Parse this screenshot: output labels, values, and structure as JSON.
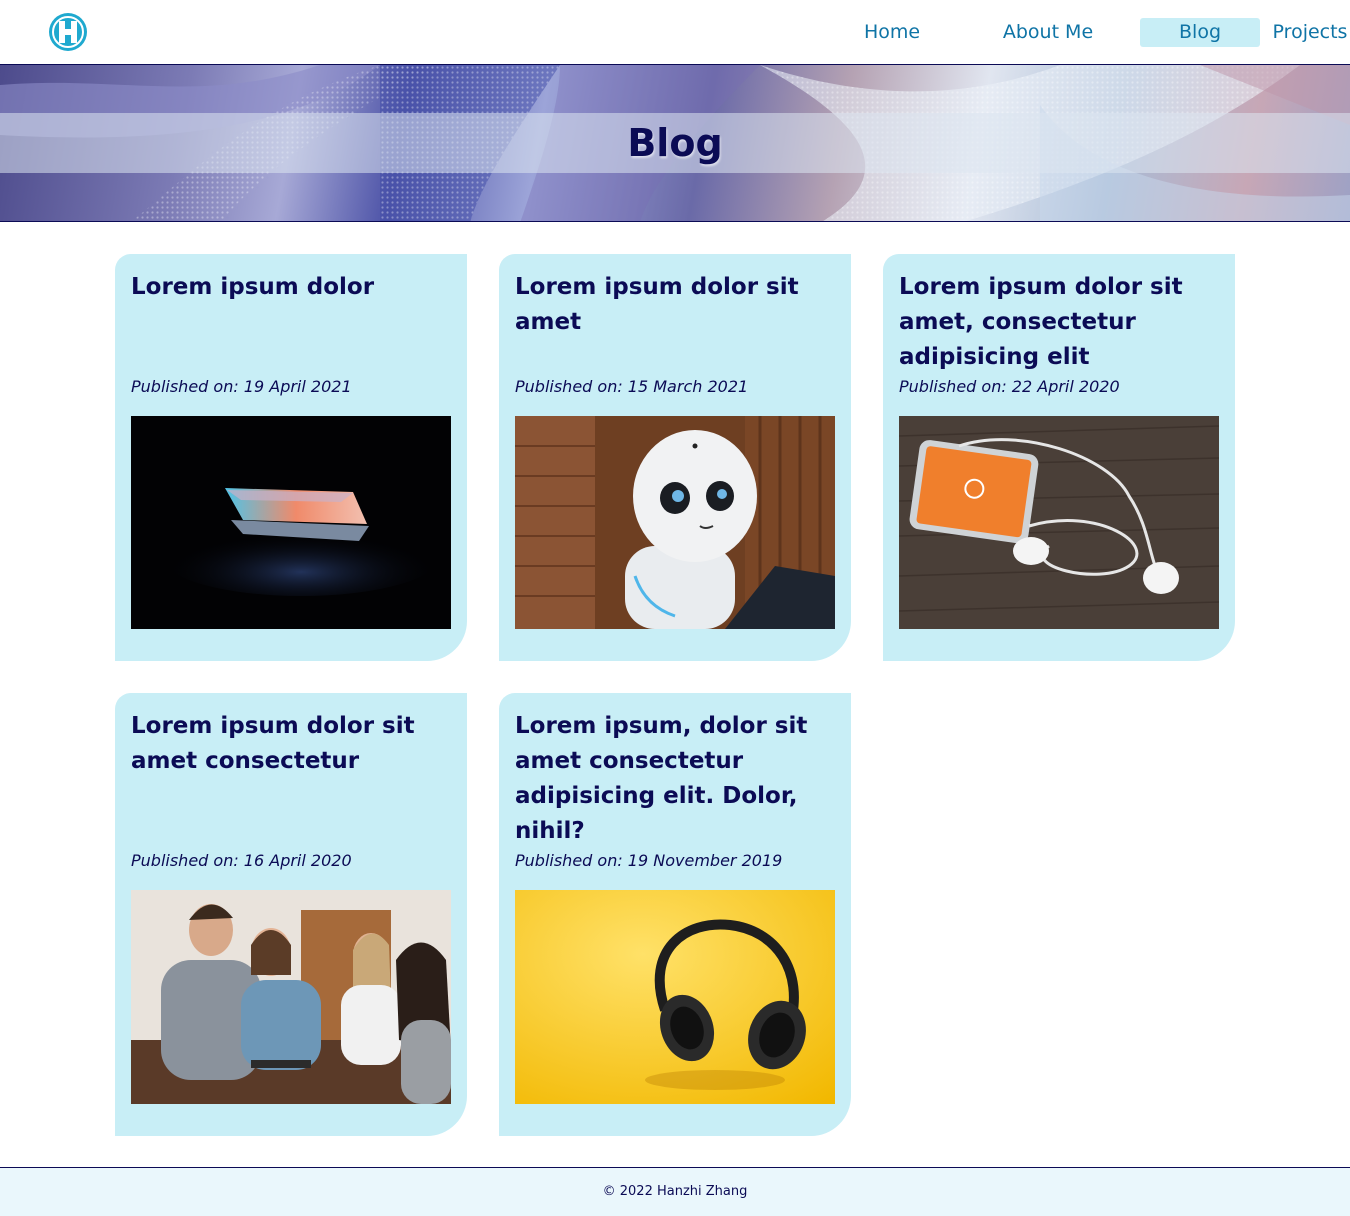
{
  "header": {
    "logo_letter": "H",
    "nav": [
      {
        "label": "Home",
        "active": false
      },
      {
        "label": "About Me",
        "active": false
      },
      {
        "label": "Blog",
        "active": true
      },
      {
        "label": "Projects",
        "active": false
      }
    ]
  },
  "hero": {
    "title": "Blog"
  },
  "posts": [
    {
      "title": "Lorem ipsum dolor",
      "date": "Published on: 19 April 2021",
      "image_icon": "laptop-photo"
    },
    {
      "title": "Lorem ipsum dolor sit amet",
      "date": "Published on: 15 March 2021",
      "image_icon": "robot-photo"
    },
    {
      "title": "Lorem ipsum dolor sit amet, consectetur adipisicing elit",
      "date": "Published on: 22 April 2020",
      "image_icon": "phone-earphones-photo"
    },
    {
      "title": "Lorem ipsum dolor sit amet consectetur",
      "date": "Published on: 16 April 2020",
      "image_icon": "people-meeting-photo"
    },
    {
      "title": "Lorem ipsum, dolor sit amet consectetur adipisicing elit. Dolor, nihil?",
      "date": "Published on: 19 November 2019",
      "image_icon": "headphones-photo"
    }
  ],
  "footer": {
    "copyright": "© 2022 Hanzhi Zhang"
  },
  "colors": {
    "card_bg": "#c8eef6",
    "text_dark": "#0b0b55",
    "nav_text": "#0f74a6",
    "logo": "#1fa9cf",
    "footer_bg": "#eaf7fc"
  }
}
